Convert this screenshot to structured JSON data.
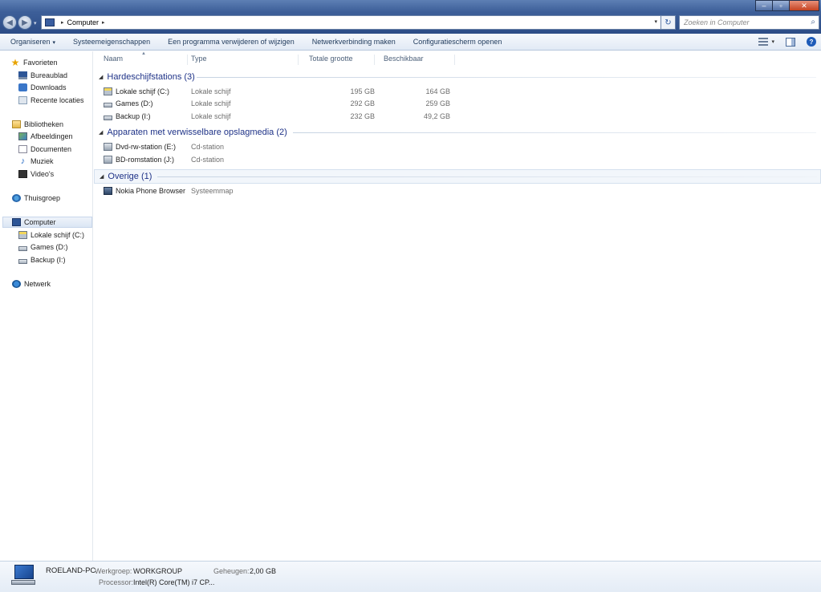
{
  "window": {
    "minimize": "–",
    "maximize": "▫",
    "close": "✕"
  },
  "address": {
    "crumb": "Computer",
    "sep": "▸",
    "dropdown": "▾",
    "refresh": "↻"
  },
  "search": {
    "placeholder": "Zoeken in Computer",
    "icon": "⌕"
  },
  "nav_buttons": {
    "back": "◀",
    "forward": "▶",
    "recent": "▾"
  },
  "toolbar": {
    "organize": "Organiseren",
    "caret": "▾",
    "system_properties": "Systeemeigenschappen",
    "uninstall": "Een programma verwijderen of wijzigen",
    "map_network": "Netwerkverbinding maken",
    "control_panel": "Configuratiescherm openen",
    "view_caret": "▾",
    "help": "?"
  },
  "navigation": {
    "favorites": {
      "label": "Favorieten",
      "icon": "★"
    },
    "fav_items": [
      "Bureaublad",
      "Downloads",
      "Recente locaties"
    ],
    "libraries": "Bibliotheken",
    "lib_items": [
      "Afbeeldingen",
      "Documenten",
      "Muziek",
      "Video's"
    ],
    "music_icon": "♪",
    "homegroup": "Thuisgroep",
    "computer": "Computer",
    "computer_items": [
      "Lokale schijf (C:)",
      "Games (D:)",
      "Backup (I:)"
    ],
    "network": "Netwerk"
  },
  "columns": {
    "name": "Naam",
    "type": "Type",
    "total": "Totale grootte",
    "free": "Beschikbaar",
    "sort_indicator": "▲"
  },
  "groups": {
    "hdd": {
      "title": "Hardeschijfstations (3)",
      "toggle": "◢",
      "items": [
        {
          "name": "Lokale schijf (C:)",
          "type": "Lokale schijf",
          "total": "195 GB",
          "free": "164 GB"
        },
        {
          "name": "Games (D:)",
          "type": "Lokale schijf",
          "total": "292 GB",
          "free": "259 GB"
        },
        {
          "name": "Backup (I:)",
          "type": "Lokale schijf",
          "total": "232 GB",
          "free": "49,2 GB"
        }
      ]
    },
    "removable": {
      "title": "Apparaten met verwisselbare opslagmedia (2)",
      "toggle": "◢",
      "items": [
        {
          "name": "Dvd-rw-station (E:)",
          "type": "Cd-station"
        },
        {
          "name": "BD-romstation (J:)",
          "type": "Cd-station"
        }
      ]
    },
    "other": {
      "title": "Overige (1)",
      "toggle": "◢",
      "items": [
        {
          "name": "Nokia Phone Browser",
          "type": "Systeemmap"
        }
      ]
    }
  },
  "details": {
    "pc_name": "ROELAND-PC",
    "workgroup_label": "Werkgroep:",
    "workgroup": "WORKGROUP",
    "memory_label": "Geheugen:",
    "memory": "2,00 GB",
    "processor_label": "Processor:",
    "processor": "Intel(R) Core(TM) i7 CP..."
  }
}
